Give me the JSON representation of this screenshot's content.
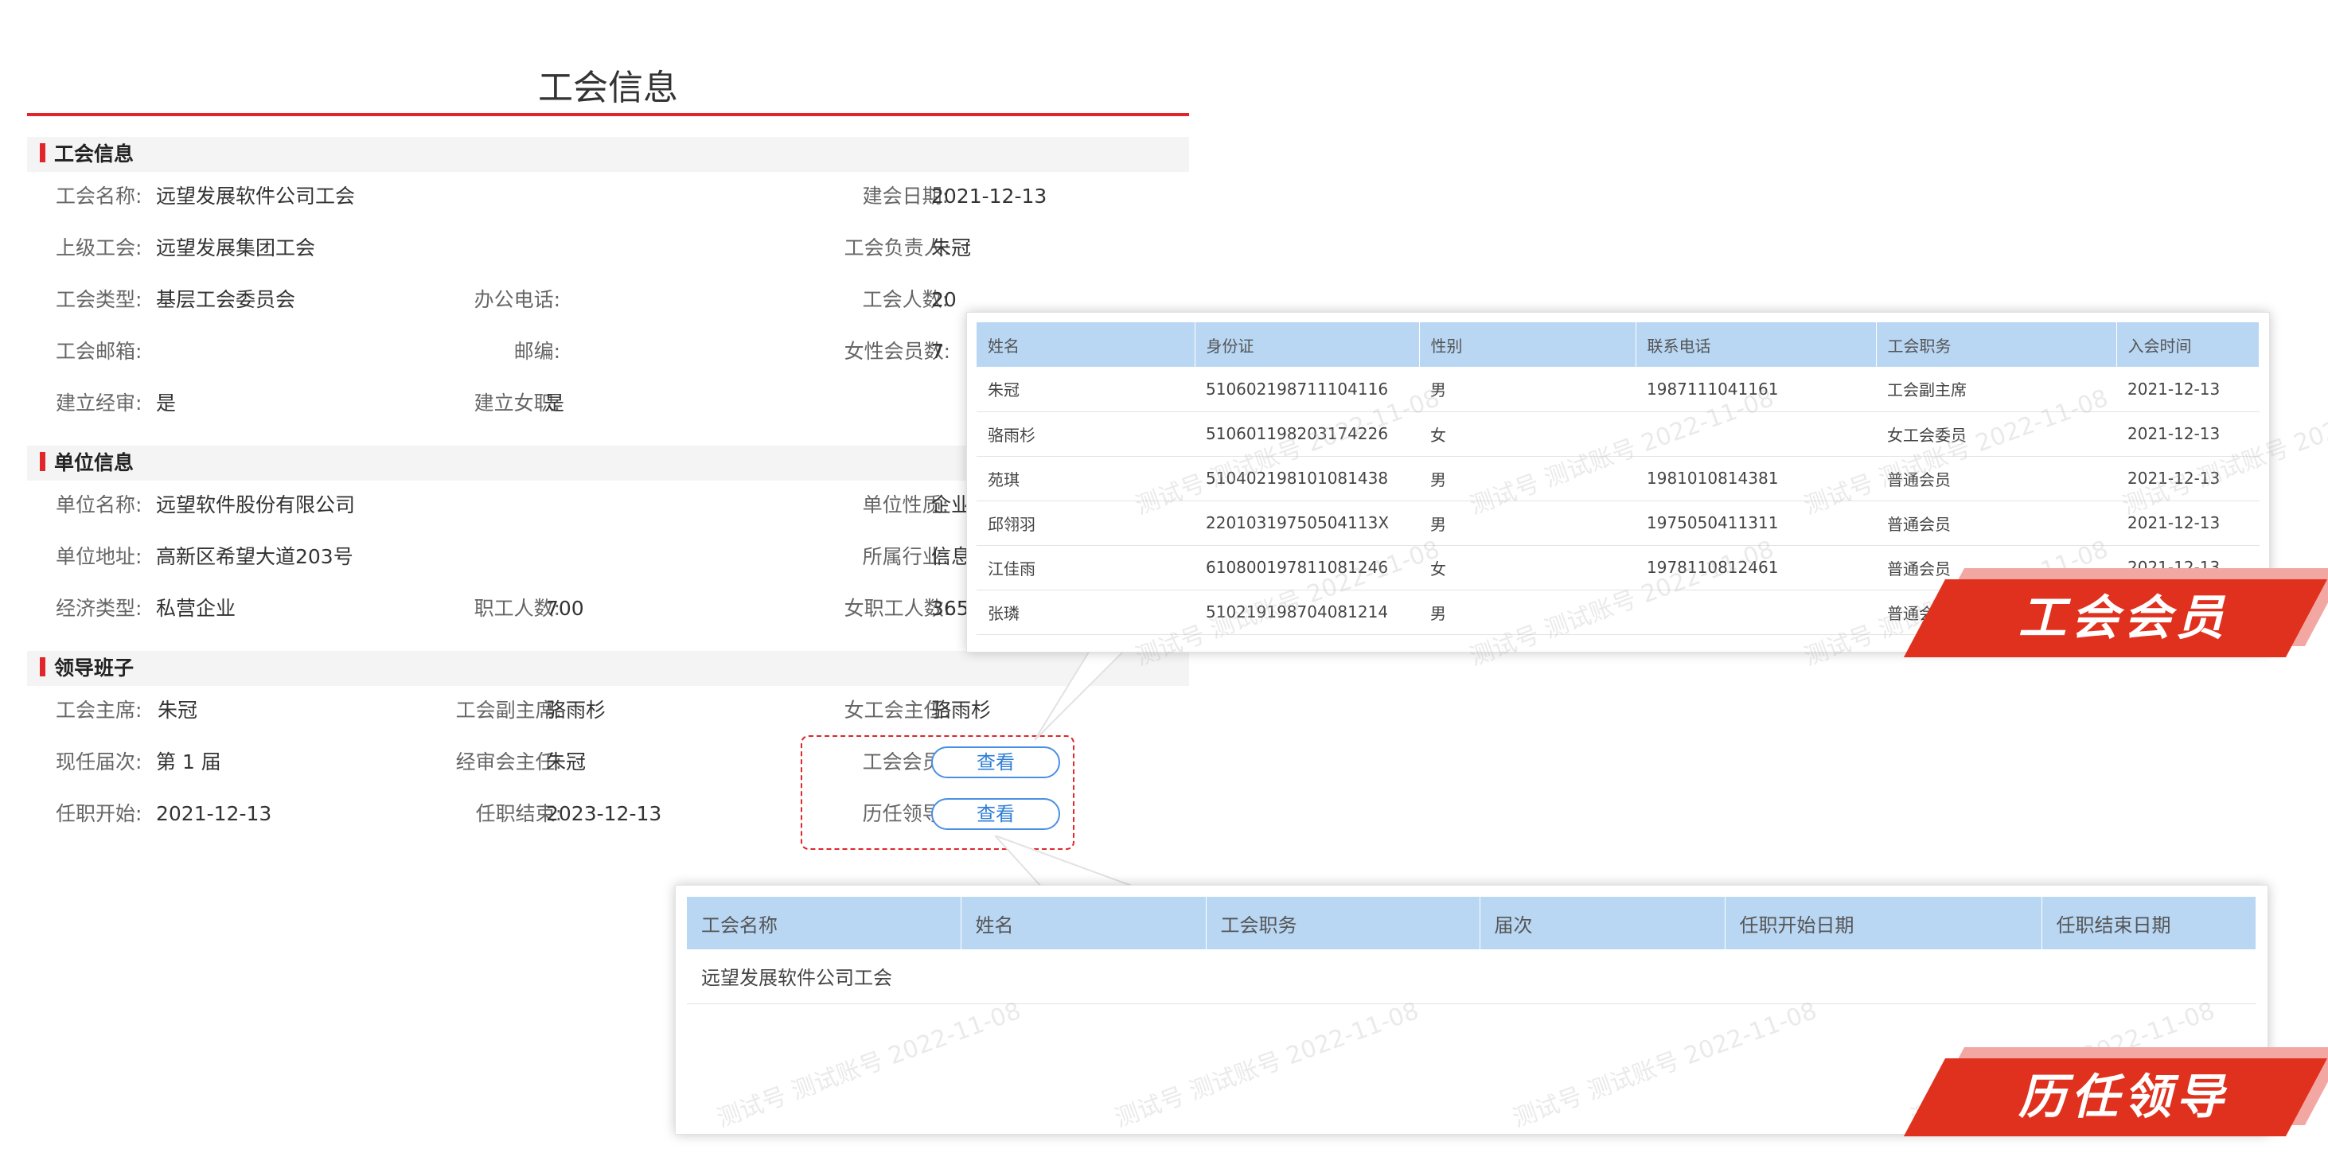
{
  "page": {
    "title": "工会信息"
  },
  "union_section": {
    "title": "工会信息",
    "fields": {
      "name": {
        "label": "工会名称:",
        "value": "远望发展软件公司工会"
      },
      "founded": {
        "label": "建会日期:",
        "value": "2021-12-13"
      },
      "parent": {
        "label": "上级工会:",
        "value": "远望发展集团工会"
      },
      "leader": {
        "label": "工会负责人:",
        "value": "朱冠"
      },
      "type": {
        "label": "工会类型:",
        "value": "基层工会委员会"
      },
      "phone": {
        "label": "办公电话:",
        "value": ""
      },
      "member_count": {
        "label": "工会人数:",
        "value": "20"
      },
      "email": {
        "label": "工会邮箱:",
        "value": ""
      },
      "postcode": {
        "label": "邮编:",
        "value": ""
      },
      "female_count": {
        "label": "女性会员数:",
        "value": "7"
      },
      "audit": {
        "label": "建立经审:",
        "value": "是"
      },
      "female_org": {
        "label": "建立女职:",
        "value": "是"
      }
    }
  },
  "company_section": {
    "title": "单位信息",
    "fields": {
      "name": {
        "label": "单位名称:",
        "value": "远望软件股份有限公司"
      },
      "nature": {
        "label": "单位性质:",
        "value": "企业"
      },
      "address": {
        "label": "单位地址:",
        "value": "高新区希望大道203号"
      },
      "industry": {
        "label": "所属行业:",
        "value": "信息"
      },
      "econ_type": {
        "label": "经济类型:",
        "value": "私营企业"
      },
      "staff": {
        "label": "职工人数:",
        "value": "700"
      },
      "female_staff": {
        "label": "女职工人数:",
        "value": "365"
      }
    }
  },
  "leadership_section": {
    "title": "领导班子",
    "fields": {
      "chair": {
        "label": "工会主席:",
        "value": "朱冠"
      },
      "vice_chair": {
        "label": "工会副主席:",
        "value": "骆雨杉"
      },
      "women_director": {
        "label": "女工会主任:",
        "value": "骆雨杉"
      },
      "term": {
        "label": "现任届次:",
        "value": "第 1 届"
      },
      "audit_director": {
        "label": "经审会主任:",
        "value": "朱冠"
      },
      "members": {
        "label": "工会会员:",
        "button": "查看"
      },
      "start": {
        "label": "任职开始:",
        "value": "2021-12-13"
      },
      "end": {
        "label": "任职结束:",
        "value": "2023-12-13"
      },
      "past_leaders": {
        "label": "历任领导:",
        "button": "查看"
      }
    }
  },
  "members_popup": {
    "ribbon": "工会会员",
    "columns": [
      "姓名",
      "身份证",
      "性别",
      "联系电话",
      "工会职务",
      "入会时间"
    ],
    "rows": [
      [
        "朱冠",
        "510602198711104116",
        "男",
        "1987111041161",
        "工会副主席",
        "2021-12-13"
      ],
      [
        "骆雨杉",
        "510601198203174226",
        "女",
        "",
        "女工会委员",
        "2021-12-13"
      ],
      [
        "苑琪",
        "510402198101081438",
        "男",
        "1981010814381",
        "普通会员",
        "2021-12-13"
      ],
      [
        "邱翎羽",
        "22010319750504113X",
        "男",
        "1975050411311",
        "普通会员",
        "2021-12-13"
      ],
      [
        "江佳雨",
        "610800197811081246",
        "女",
        "1978110812461",
        "普通会员",
        "2021-12-13"
      ],
      [
        "张璘",
        "510219198704081214",
        "男",
        "",
        "普通会员",
        ""
      ]
    ]
  },
  "leaders_popup": {
    "ribbon": "历任领导",
    "columns": [
      "工会名称",
      "姓名",
      "工会职务",
      "届次",
      "任职开始日期",
      "任职结束日期"
    ],
    "rows": [
      [
        "远望发展软件公司工会",
        "",
        "",
        "",
        "",
        ""
      ]
    ]
  },
  "watermark_text": "测试号 测试账号 2022-11-08",
  "colors": {
    "accent_red": "#e0252b",
    "header_blue": "#b9d7f3",
    "button_blue": "#4a90e2"
  }
}
